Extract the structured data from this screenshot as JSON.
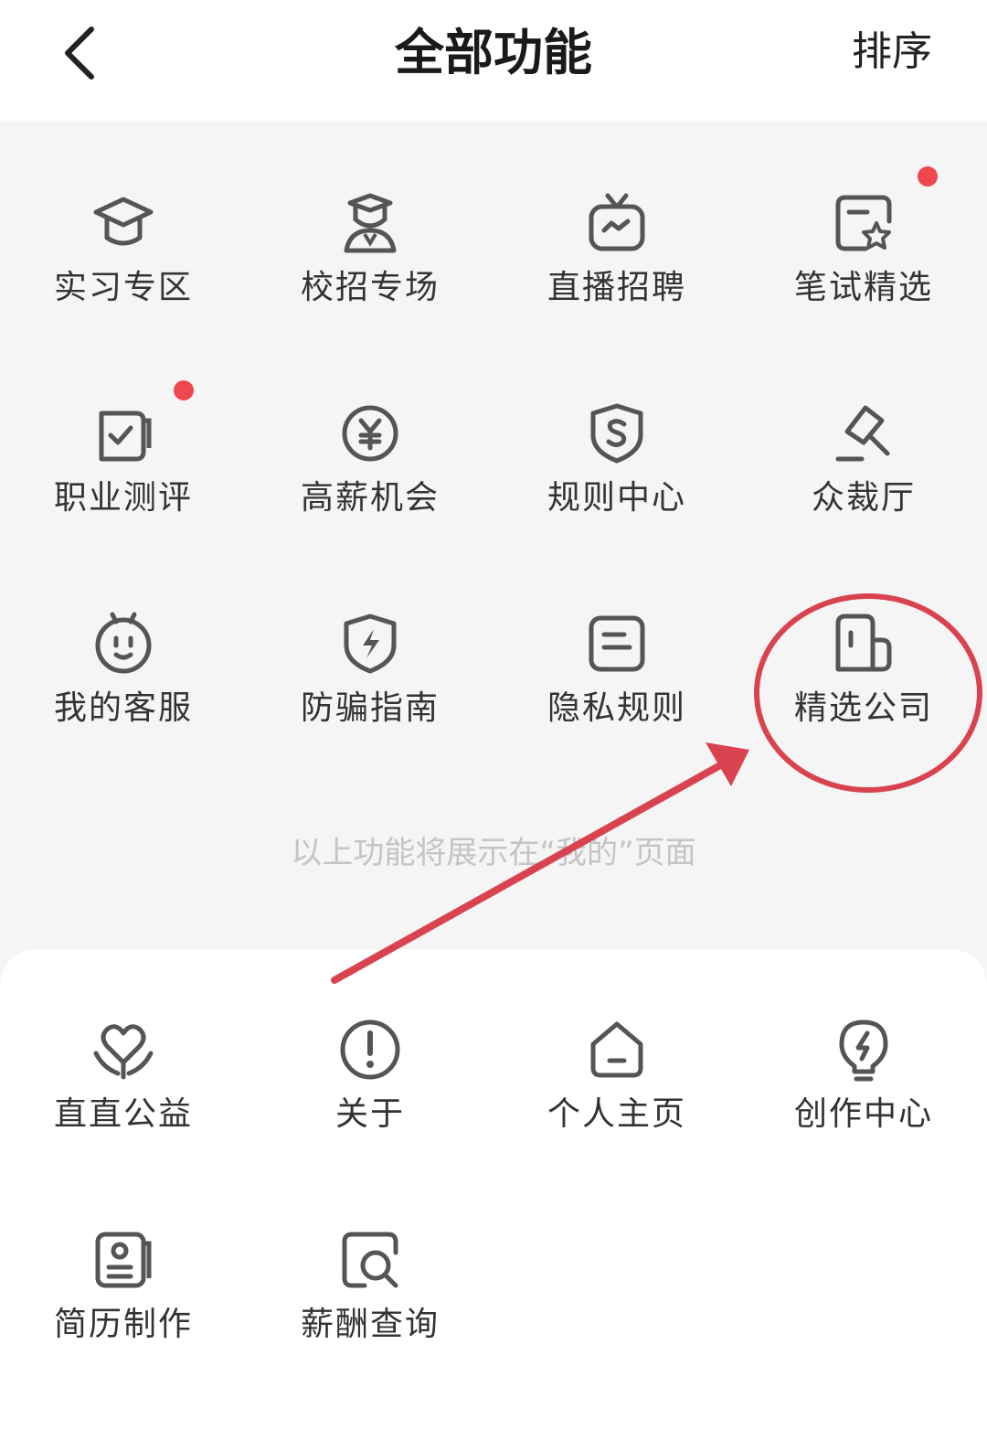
{
  "header": {
    "title": "全部功能",
    "sort_label": "排序",
    "back_icon": "chevron-left-icon"
  },
  "top_section": {
    "items": [
      {
        "label": "实习专区",
        "icon": "graduation-cap-icon"
      },
      {
        "label": "校招专场",
        "icon": "graduate-student-icon"
      },
      {
        "label": "直播招聘",
        "icon": "live-tv-icon"
      },
      {
        "label": "笔试精选",
        "icon": "star-note-icon",
        "badge": true
      },
      {
        "label": "职业测评",
        "icon": "check-board-icon",
        "badge": true
      },
      {
        "label": "高薪机会",
        "icon": "yen-coin-icon"
      },
      {
        "label": "规则中心",
        "icon": "shield-s-icon"
      },
      {
        "label": "众裁厅",
        "icon": "gavel-icon"
      },
      {
        "label": "我的客服",
        "icon": "robot-face-icon"
      },
      {
        "label": "防骗指南",
        "icon": "shield-lightning-icon"
      },
      {
        "label": "隐私规则",
        "icon": "document-lines-icon"
      },
      {
        "label": "精选公司",
        "icon": "building-icon"
      }
    ],
    "hint": "以上功能将展示在“我的”页面"
  },
  "bottom_section": {
    "items": [
      {
        "label": "直直公益",
        "icon": "heart-hands-icon"
      },
      {
        "label": "关于",
        "icon": "info-exclamation-icon"
      },
      {
        "label": "个人主页",
        "icon": "home-icon"
      },
      {
        "label": "创作中心",
        "icon": "lightbulb-icon"
      },
      {
        "label": "简历制作",
        "icon": "resume-icon"
      },
      {
        "label": "薪酬查询",
        "icon": "search-frame-icon"
      }
    ]
  },
  "colors": {
    "badge": "#f04650",
    "annotation": "#d9434f",
    "icon_stroke": "#555555",
    "hint_text": "#c4c4c4"
  }
}
